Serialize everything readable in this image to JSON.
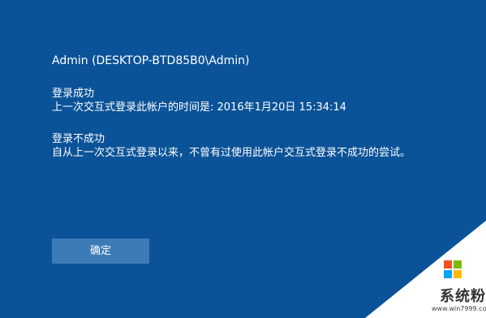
{
  "dialog": {
    "user": "Admin (DESKTOP-BTD85B0\\Admin)",
    "success_heading": "登录成功",
    "success_detail": "上一次交互式登录此帐户的时间是: 2016年1月20日 15:34:14",
    "failure_heading": "登录不成功",
    "failure_detail": "自从上一次交互式登录以来，不曾有过使用此帐户交互式登录不成功的尝试。",
    "ok_label": "确定"
  },
  "watermark": {
    "brand": "系统粉",
    "url": "www.win7999.com",
    "icon": "windows-logo-icon",
    "logo_colors": [
      "#f25022",
      "#7fba00",
      "#00a4ef",
      "#ffb900"
    ]
  },
  "colors": {
    "background": "#0b5398",
    "button": "#3d7bb8",
    "text": "#ffffff"
  }
}
